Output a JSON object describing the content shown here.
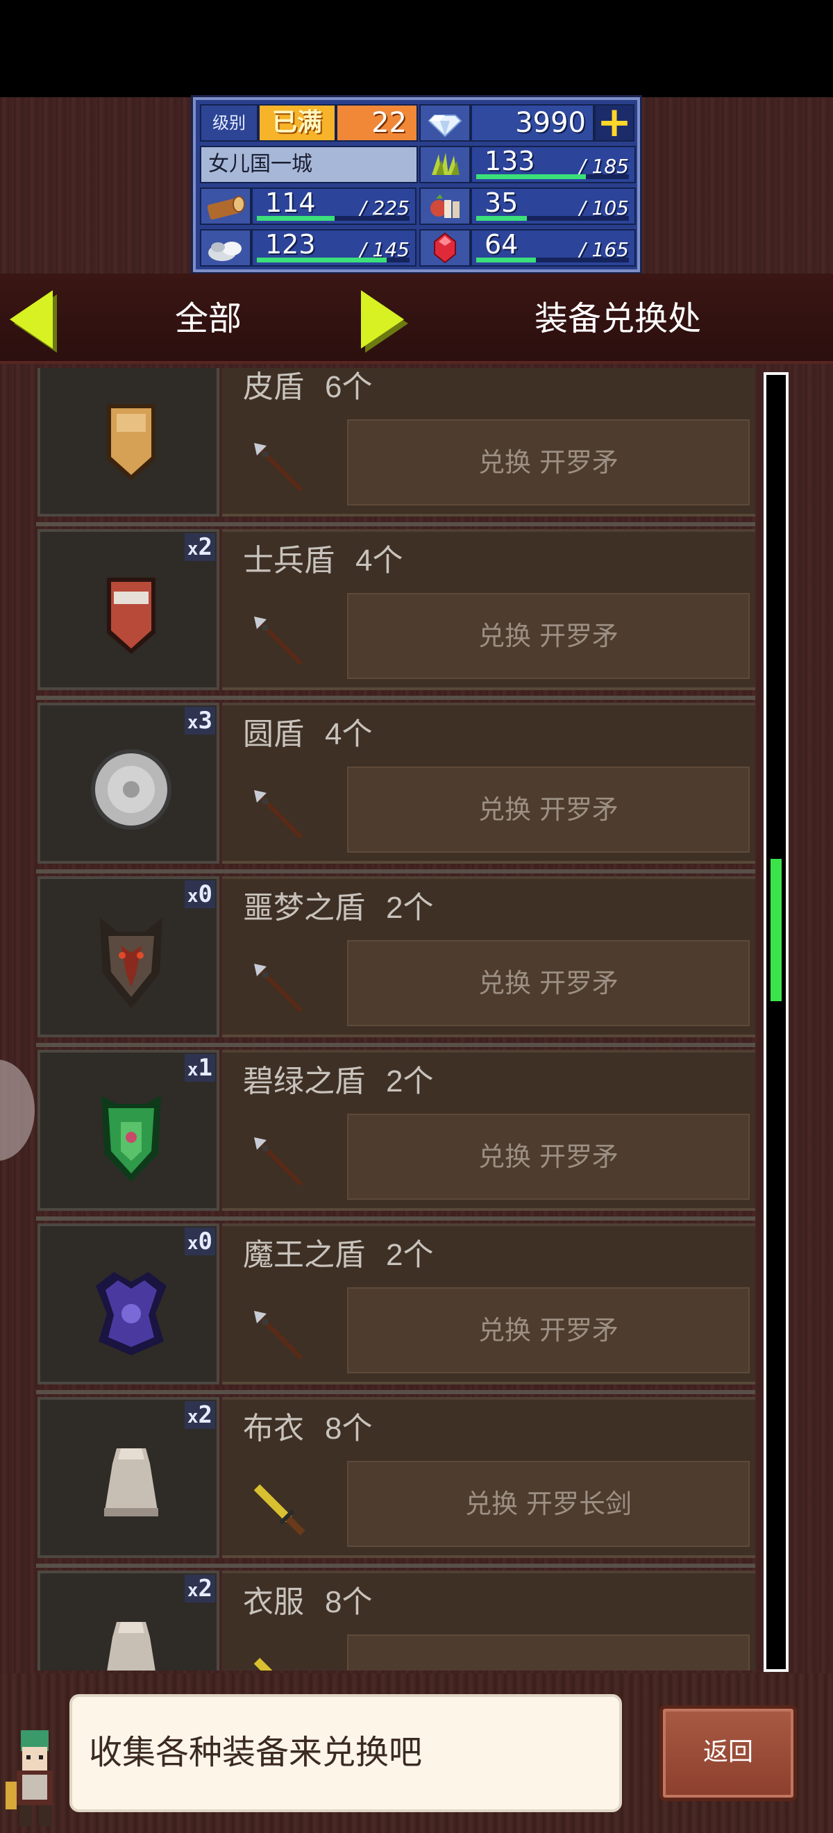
{
  "hud": {
    "level_label": "级别",
    "level_status": "已满",
    "level_value": "22",
    "gems": "3990",
    "plus_label": "+",
    "town_name": "女儿国一城",
    "resources": [
      {
        "name": "grass",
        "current": "133",
        "max": "/ 185",
        "fill": 0.72
      },
      {
        "name": "wood",
        "current": "114",
        "max": "/ 225",
        "fill": 0.51
      },
      {
        "name": "food",
        "current": "35",
        "max": "/ 105",
        "fill": 0.33
      },
      {
        "name": "stone",
        "current": "123",
        "max": "/ 145",
        "fill": 0.85
      },
      {
        "name": "ruby",
        "current": "64",
        "max": "/ 165",
        "fill": 0.39
      }
    ]
  },
  "header": {
    "filter_label": "全部",
    "shop_title": "装备兑换处"
  },
  "items": [
    {
      "name": "皮盾",
      "qty": "6个",
      "count": "",
      "action": "兑换 开罗矛",
      "icon": "leather-shield-icon",
      "req_icon": "spear-icon"
    },
    {
      "name": "士兵盾",
      "qty": "4个",
      "count": "2",
      "action": "兑换 开罗矛",
      "icon": "soldier-shield-icon",
      "req_icon": "spear-icon"
    },
    {
      "name": "圆盾",
      "qty": "4个",
      "count": "3",
      "action": "兑换 开罗矛",
      "icon": "round-shield-icon",
      "req_icon": "spear-icon"
    },
    {
      "name": "噩梦之盾",
      "qty": "2个",
      "count": "0",
      "action": "兑换 开罗矛",
      "icon": "nightmare-shield-icon",
      "req_icon": "spear-icon"
    },
    {
      "name": "碧绿之盾",
      "qty": "2个",
      "count": "1",
      "action": "兑换 开罗矛",
      "icon": "jade-shield-icon",
      "req_icon": "spear-icon"
    },
    {
      "name": "魔王之盾",
      "qty": "2个",
      "count": "0",
      "action": "兑换 开罗矛",
      "icon": "demon-shield-icon",
      "req_icon": "spear-icon"
    },
    {
      "name": "布衣",
      "qty": "8个",
      "count": "2",
      "action": "兑换 开罗长剑",
      "icon": "cloth-robe-icon",
      "req_icon": "longsword-icon"
    },
    {
      "name": "衣服",
      "qty": "8个",
      "count": "2",
      "action": "",
      "icon": "clothes-icon",
      "req_icon": "longsword-icon"
    }
  ],
  "scroll": {
    "position": 0.42,
    "visible": 0.11
  },
  "footer": {
    "dialog": "收集各种装备来兑换吧",
    "back_label": "返回"
  },
  "colors": {
    "accent_yellow": "#d8f123",
    "scroll_green": "#3be34a",
    "hud_blue": "#2a3f8c"
  }
}
